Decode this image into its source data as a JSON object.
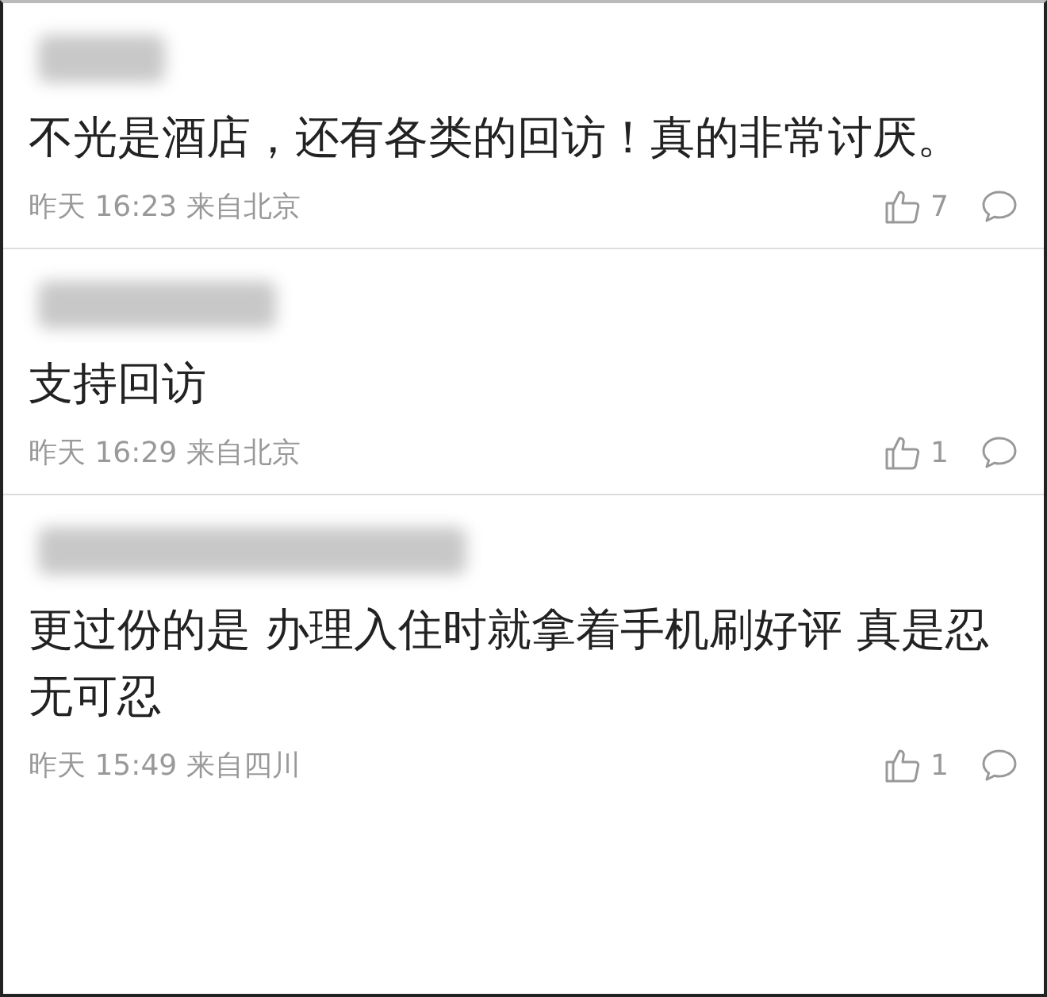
{
  "comments": [
    {
      "text": "不光是酒店，还有各类的回访！真的非常讨厌。",
      "time": "昨天 16:23",
      "location": "来自北京",
      "likes": "7"
    },
    {
      "text": "支持回访",
      "time": "昨天 16:29",
      "location": "来自北京",
      "likes": "1"
    },
    {
      "text": "更过份的是 办理入住时就拿着手机刷好评 真是忍无可忍",
      "time": "昨天 15:49",
      "location": "来自四川",
      "likes": "1"
    }
  ]
}
